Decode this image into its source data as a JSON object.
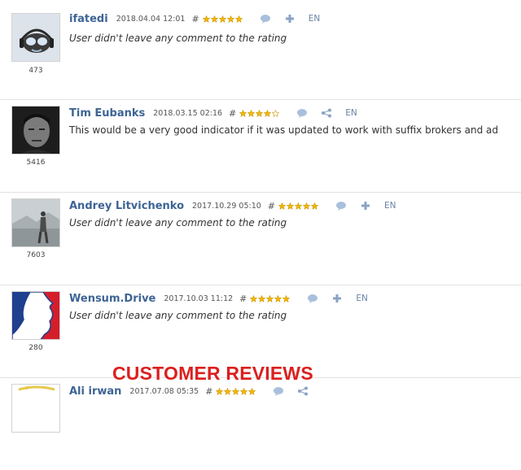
{
  "reviews": [
    {
      "user": "ifatedi",
      "date": "2018.04.04 12:01",
      "hash": "#",
      "rating": 5,
      "count": "473",
      "comment": "User didn't leave any comment to the rating",
      "lang": "EN",
      "avatar": "avatar-robot-icon",
      "action": "plus-icon"
    },
    {
      "user": "Tim Eubanks",
      "date": "2018.03.15 02:16",
      "hash": "#",
      "rating": 4,
      "count": "5416",
      "comment": "This would be a very good indicator if it was updated to work with suffix brokers and ad",
      "lang": "EN",
      "avatar": "avatar-portrait-icon",
      "action": "share-icon"
    },
    {
      "user": "Andrey Litvichenko",
      "date": "2017.10.29 05:10",
      "hash": "#",
      "rating": 5,
      "count": "7603",
      "comment": "User didn't leave any comment to the rating",
      "lang": "EN",
      "avatar": "avatar-figure-icon",
      "action": "plus-icon"
    },
    {
      "user": "Wensum.Drive",
      "date": "2017.10.03 11:12",
      "hash": "#",
      "rating": 5,
      "count": "280",
      "comment": "User didn't leave any comment to the rating",
      "lang": "EN",
      "avatar": "avatar-silhouette-icon",
      "action": "plus-icon"
    },
    {
      "user": "Ali irwan",
      "date": "2017.07.08 05:35",
      "hash": "#",
      "rating": 5,
      "count": "",
      "comment": "",
      "lang": "",
      "avatar": "avatar-logo-icon",
      "action": "share-icon"
    }
  ],
  "banner": "CUSTOMER REVIEWS",
  "colors": {
    "username": "#3d6494",
    "star": "#f2b705",
    "banner": "#dc1f1f",
    "icon": "#8aa3c4"
  }
}
